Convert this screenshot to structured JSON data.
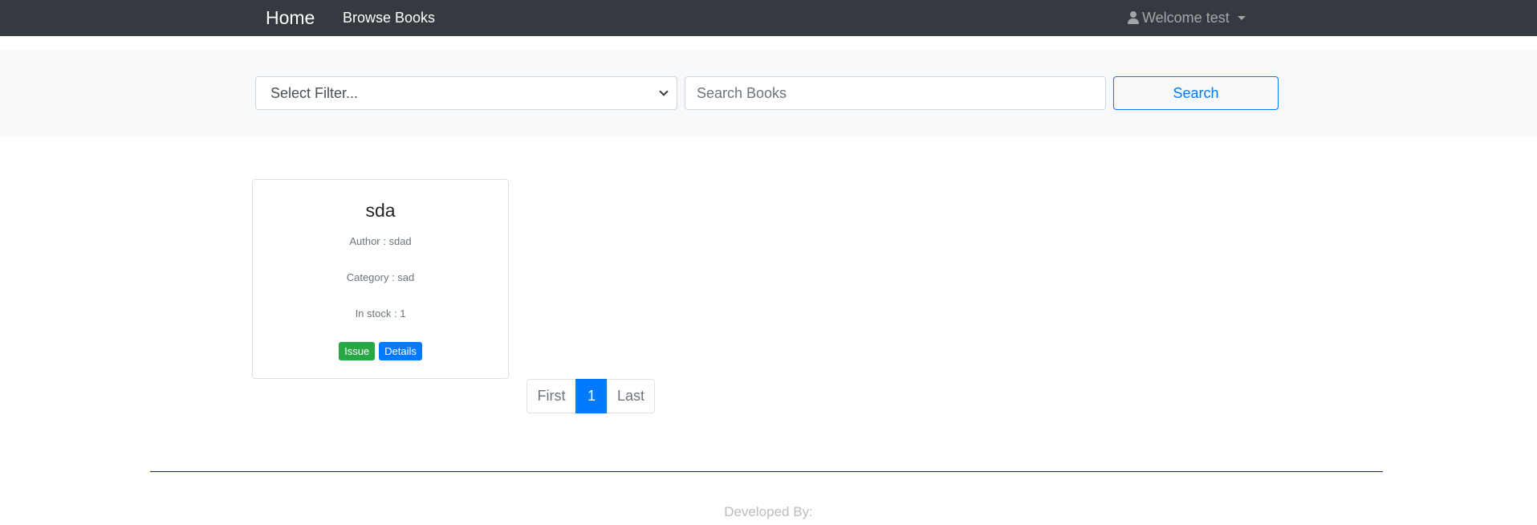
{
  "navbar": {
    "brand": "Home",
    "links": [
      "Browse Books"
    ],
    "user_menu_label": "Welcome test"
  },
  "search": {
    "filter_selected": "Select Filter...",
    "input_placeholder": "Search Books",
    "input_value": "",
    "button_label": "Search"
  },
  "books": [
    {
      "title": "sda",
      "author": "Author : sdad",
      "category": "Category : sad",
      "stock": "In stock : 1",
      "issue_label": "Issue",
      "details_label": "Details"
    }
  ],
  "pagination": {
    "first_label": "First",
    "current_page": "1",
    "last_label": "Last"
  },
  "footer": {
    "text": "Developed By:"
  },
  "colors": {
    "navbar_bg": "#343a40",
    "primary": "#007bff",
    "success": "#28a745",
    "footer_rule": "#1b16b8"
  },
  "icons": {
    "user_menu": "user-icon",
    "dropdown": "caret-down-icon",
    "select": "chevron-down-icon"
  }
}
